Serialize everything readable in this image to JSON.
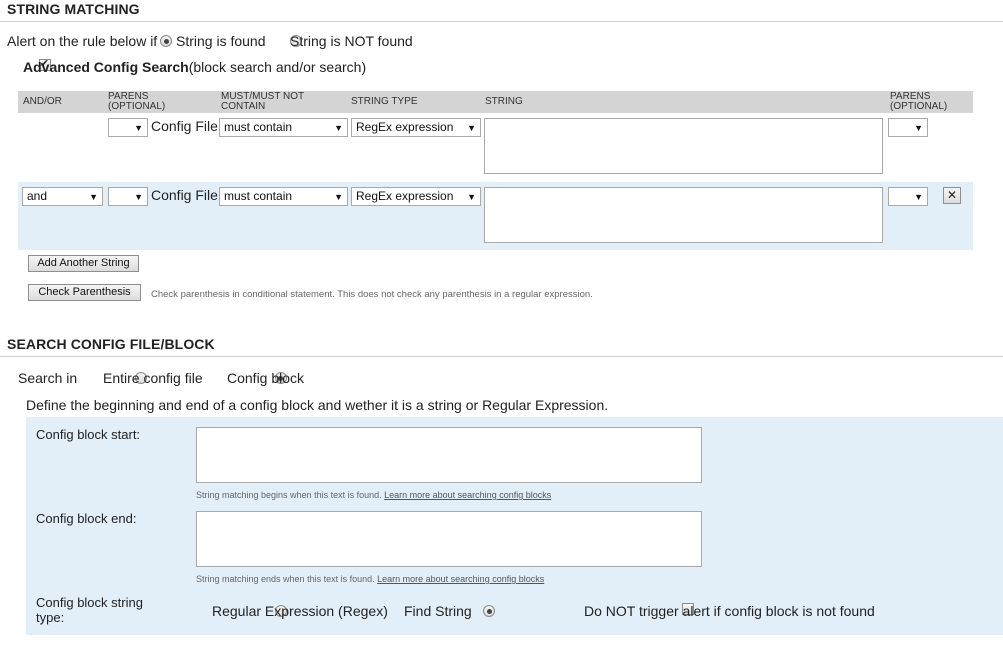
{
  "string_matching": {
    "title": "STRING MATCHING",
    "alert_label": "Alert on the rule below if",
    "alert_opt_found": "String is found",
    "alert_opt_not_found": "String is NOT found",
    "advanced_label": "Advanced Config Search",
    "advanced_suffix": "(block search and/or search)",
    "headers": {
      "andor": "AND/OR",
      "parens_left_1": "PARENS",
      "parens_left_2": "(OPTIONAL)",
      "must_1": "MUST/MUST NOT",
      "must_2": "CONTAIN",
      "string_type": "STRING TYPE",
      "string": "STRING",
      "parens_right_1": "PARENS",
      "parens_right_2": "(OPTIONAL)"
    },
    "rows": [
      {
        "andor": "",
        "paren_open": "",
        "target": "Config File",
        "must": "must contain",
        "string_type": "RegEx expression",
        "string": "",
        "paren_close": ""
      },
      {
        "andor": "and",
        "paren_open": "",
        "target": "Config File",
        "must": "must contain",
        "string_type": "RegEx expression",
        "string": "",
        "paren_close": "",
        "remove_label": "✕"
      }
    ],
    "add_button": "Add Another String",
    "check_button": "Check Parenthesis",
    "check_note": "Check parenthesis in conditional statement. This does not check any parenthesis in a regular expression."
  },
  "search_config": {
    "title": "SEARCH CONFIG FILE/BLOCK",
    "search_in_label": "Search in",
    "opt_entire": "Entire config file",
    "opt_block": "Config block",
    "define_text": "Define the beginning and end of a config block and wether it is a string or Regular Expression.",
    "block_start_label": "Config block start:",
    "block_start_value": "",
    "block_start_help": "String matching begins when this text is found.",
    "block_start_link": "Learn more about searching config blocks",
    "block_end_label": "Config block end:",
    "block_end_value": "",
    "block_end_help": "String matching ends when this text is found.",
    "block_end_link": "Learn more about searching config blocks",
    "type_label_1": "Config block string",
    "type_label_2": "type:",
    "opt_regex": "Regular Expression (Regex)",
    "opt_find": "Find String",
    "no_trigger_label": "Do NOT trigger alert if config block is not found"
  },
  "colors": {
    "table_header_bg": "#d4d4d4",
    "row_alt_bg": "#e2eef8",
    "block_panel_bg": "#e2eef8"
  }
}
